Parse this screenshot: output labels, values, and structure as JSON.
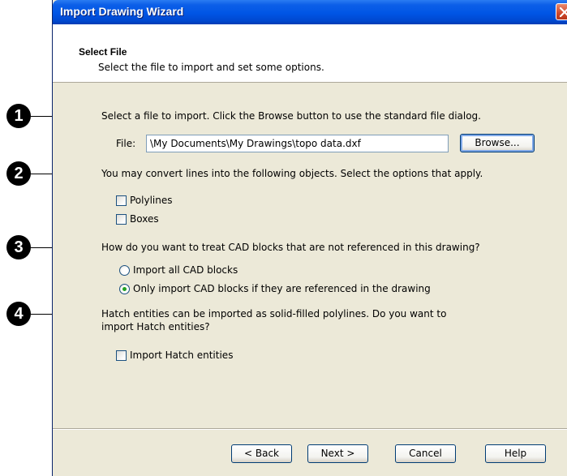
{
  "window": {
    "title": "Import Drawing Wizard"
  },
  "header": {
    "title": "Select File",
    "subtitle": "Select the file to import and set some options."
  },
  "callouts": [
    "1",
    "2",
    "3",
    "4"
  ],
  "section1": {
    "instruction": "Select a file to import. Click the Browse button to use the standard file dialog.",
    "file_label": "File:",
    "file_value": "\\My Documents\\My Drawings\\topo data.dxf",
    "browse_label": "Browse..."
  },
  "section2": {
    "instruction": "You may convert lines into the following objects. Select the options that apply.",
    "options": [
      {
        "label": "Polylines",
        "checked": false
      },
      {
        "label": "Boxes",
        "checked": false
      }
    ]
  },
  "section3": {
    "instruction": "How do you want to treat CAD blocks that are not referenced in this drawing?",
    "options": [
      {
        "label": "Import all CAD blocks",
        "selected": false
      },
      {
        "label": "Only import CAD blocks if they are referenced in the drawing",
        "selected": true
      }
    ]
  },
  "section4": {
    "instruction_line1": "Hatch entities can be imported as solid-filled polylines. Do you want to",
    "instruction_line2": "import Hatch entities?",
    "option": {
      "label": "Import Hatch entities",
      "checked": false
    }
  },
  "footer": {
    "back_label": "< Back",
    "next_label": "Next >",
    "cancel_label": "Cancel",
    "help_label": "Help"
  },
  "colors": {
    "titlebar": "#0055e5",
    "dialog_bg": "#ece9d8",
    "radio_dot": "#21a121"
  }
}
